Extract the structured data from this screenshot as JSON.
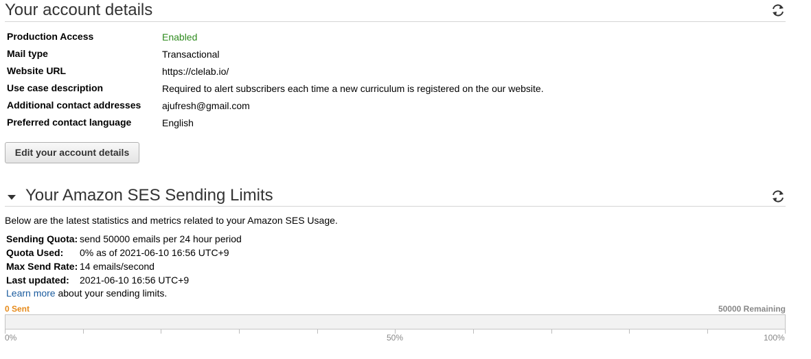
{
  "account": {
    "title": "Your account details",
    "rows": [
      {
        "label": "Production Access",
        "value": "Enabled"
      },
      {
        "label": "Mail type",
        "value": "Transactional"
      },
      {
        "label": "Website URL",
        "value": "https://clelab.io/"
      },
      {
        "label": "Use case description",
        "value": "Required to alert subscribers each time a new curriculum is registered on the our website."
      },
      {
        "label": "Additional contact addresses",
        "value": "ajufresh@gmail.com"
      },
      {
        "label": "Preferred contact language",
        "value": "English"
      }
    ],
    "edit_button": "Edit your account details"
  },
  "limits": {
    "title": "Your Amazon SES Sending Limits",
    "intro": "Below are the latest statistics and metrics related to your Amazon SES Usage.",
    "quota_label": "Sending Quota:",
    "quota_value": "send 50000 emails per 24 hour period",
    "used_label": "Quota Used:",
    "used_value": "0% as of 2021-06-10 16:56 UTC+9",
    "rate_label": "Max Send Rate:",
    "rate_value": "14 emails/second",
    "updated_label": "Last updated:",
    "updated_value": "2021-06-10 16:56 UTC+9",
    "learn_link": "Learn more",
    "learn_suffix": "about your sending limits.",
    "sent_text": "0 Sent",
    "remaining_text": "50000 Remaining",
    "used_fraction": 0,
    "scale_labels": [
      "0%",
      "50%",
      "100%"
    ]
  },
  "colors": {
    "enabled": "#2e8b1e",
    "sent": "#e68a1a",
    "link": "#1a5b9e"
  },
  "icons": {
    "refresh": "refresh-icon",
    "collapse": "caret-down-icon"
  }
}
